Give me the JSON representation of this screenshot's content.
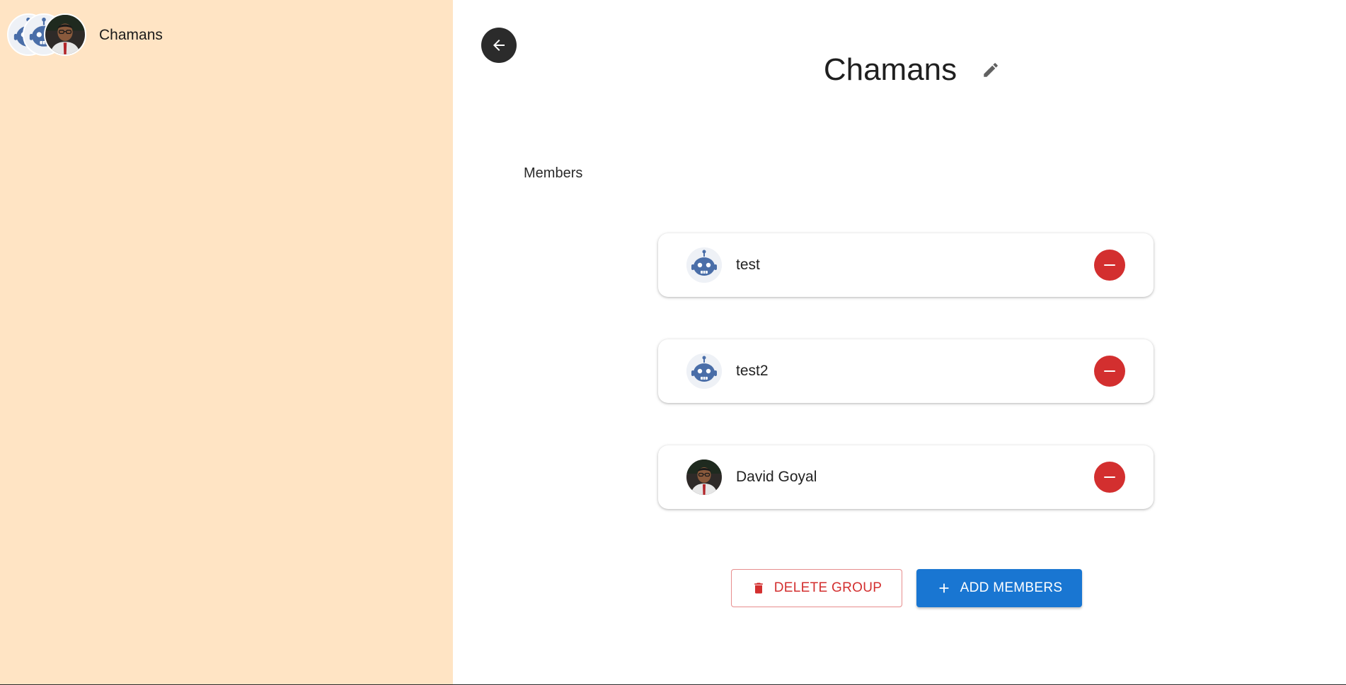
{
  "sidebar": {
    "group": {
      "name": "Chamans",
      "avatars": [
        "robot-avatar",
        "robot-avatar",
        "person-avatar"
      ]
    }
  },
  "header": {
    "title": "Chamans",
    "back_icon": "arrow-left-icon",
    "edit_icon": "pencil-icon"
  },
  "members": {
    "label": "Members",
    "items": [
      {
        "name": "test",
        "avatar": "robot-avatar"
      },
      {
        "name": "test2",
        "avatar": "robot-avatar"
      },
      {
        "name": "David Goyal",
        "avatar": "person-avatar"
      }
    ]
  },
  "actions": {
    "delete_label": "DELETE GROUP",
    "add_label": "ADD MEMBERS"
  },
  "colors": {
    "sidebar_bg": "#ffe4c4",
    "danger": "#d32f2f",
    "primary": "#1976d2"
  }
}
